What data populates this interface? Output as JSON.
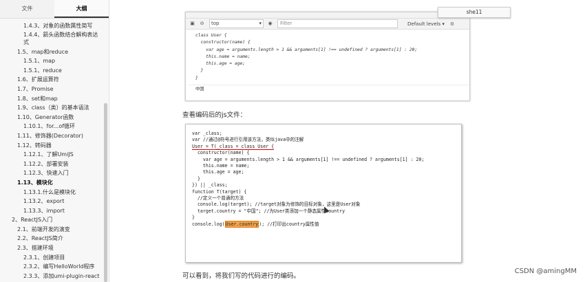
{
  "sidebar": {
    "tabs": [
      "文件",
      "大纲"
    ],
    "active_tab": 1,
    "toc": [
      {
        "text": "1.4.3、对象的函数属性简写",
        "level": 3
      },
      {
        "text": "1.4.4、箭头函数结合解构表达式",
        "level": 3,
        "wrap": true
      },
      {
        "text": "1.5、map和reduce",
        "level": 2
      },
      {
        "text": "1.5.1、map",
        "level": 3
      },
      {
        "text": "1.5.1、reduce",
        "level": 3
      },
      {
        "text": "1.6、扩展运算符",
        "level": 2
      },
      {
        "text": "1.7、Promise",
        "level": 2
      },
      {
        "text": "1.8、set和map",
        "level": 2
      },
      {
        "text": "1.9、class（类）的基本语法",
        "level": 2
      },
      {
        "text": "1.10、Generator函数",
        "level": 2
      },
      {
        "text": "1.10.1、for...of循环",
        "level": 3
      },
      {
        "text": "1.11、修饰器(Decorator)",
        "level": 2
      },
      {
        "text": "1.12、转码器",
        "level": 2
      },
      {
        "text": "1.12.1、了解UmiJS",
        "level": 3
      },
      {
        "text": "1.12.2、部署安装",
        "level": 3
      },
      {
        "text": "1.12.3、快速入门",
        "level": 3
      },
      {
        "text": "1.13、模块化",
        "level": 2,
        "bold": true
      },
      {
        "text": "1.13.1.什么是模块化",
        "level": 3
      },
      {
        "text": "1.13.2、export",
        "level": 3
      },
      {
        "text": "1.13.3、import",
        "level": 3
      },
      {
        "text": "2、ReactJS入门",
        "level": 1
      },
      {
        "text": "2.1、前端开发的演变",
        "level": 2
      },
      {
        "text": "2.2、ReactJS简介",
        "level": 2
      },
      {
        "text": "2.3、搭建环境",
        "level": 2
      },
      {
        "text": "2.3.1、创建项目",
        "level": 3
      },
      {
        "text": "2.3.2、编写HelloWorld程序",
        "level": 3
      },
      {
        "text": "2.3.3、添加umi-plugin-react",
        "level": 3
      }
    ]
  },
  "popup": {
    "label": "she11"
  },
  "console": {
    "context": "top",
    "filter_placeholder": "Filter",
    "levels": "Default levels ▾",
    "lines": [
      "class User {",
      "  constructor(name) {",
      "    var age = arguments.length > 1 && arguments[1] !== undefined ? arguments[1] : 20;",
      "    this.name = name;",
      "    this.age = age;",
      "  }",
      "",
      "}"
    ],
    "output": "中国"
  },
  "captions": {
    "middle": "查看编码后的js文件：",
    "bottom": "可以看到，将我们写的代码进行的编码。"
  },
  "code": {
    "lines": [
      "var _class;",
      "",
      "var //通过@符号进行引用该方法，类似java中的注解",
      "__UNDERLINE__",
      "  constructor(name) {",
      "    var age = arguments.length > 1 && arguments[1] !== undefined ? arguments[1] : 20;",
      "    this.name = name;",
      "    this.age = age;",
      "  }",
      "",
      "}) || _class;",
      "",
      "function T(target) {",
      "  //定义一个普通的方法",
      "  console.log(target); //target对象为修饰的目标对象，这里是User对象",
      "",
      "  target.country = \"中国\"; //为User类添加一个静态属性country",
      "}",
      "",
      "__HIGHLIGHT__"
    ],
    "underline_line": "User = T(_class = class User {",
    "highlight_prefix": "console.log(",
    "highlight_text": "User.country",
    "highlight_suffix": "); //打印出country属性值"
  },
  "watermark": "CSDN @amingMM"
}
